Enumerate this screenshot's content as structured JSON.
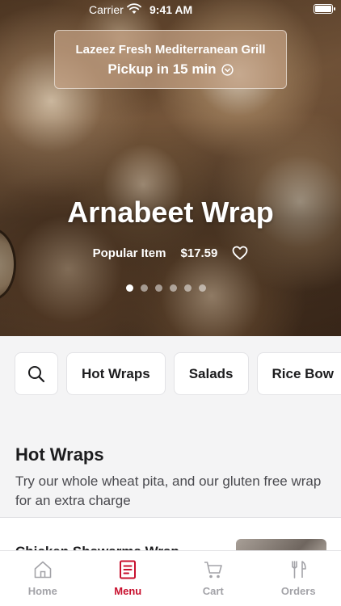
{
  "status_bar": {
    "carrier": "Carrier",
    "time": "9:41 AM"
  },
  "location": {
    "name": "Lazeez Fresh Mediterranean Grill",
    "pickup": "Pickup in 15 min"
  },
  "featured": {
    "title": "Arnabeet Wrap",
    "tag": "Popular Item",
    "price": "$17.59",
    "slide_count": 6,
    "active_slide": 1
  },
  "categories": {
    "chips": [
      "Hot Wraps",
      "Salads",
      "Rice Bow"
    ]
  },
  "section": {
    "title": "Hot Wraps",
    "description": "Try our whole wheat pita, and our gluten free wrap for an extra charge"
  },
  "first_item": {
    "name": "Chicken Shawarma Wrap"
  },
  "tabs": [
    {
      "label": "Home",
      "icon": "home-icon"
    },
    {
      "label": "Menu",
      "icon": "menu-icon"
    },
    {
      "label": "Cart",
      "icon": "cart-icon"
    },
    {
      "label": "Orders",
      "icon": "orders-icon"
    }
  ],
  "colors": {
    "accent": "#c8102e",
    "inactive": "#a3a3a8"
  }
}
